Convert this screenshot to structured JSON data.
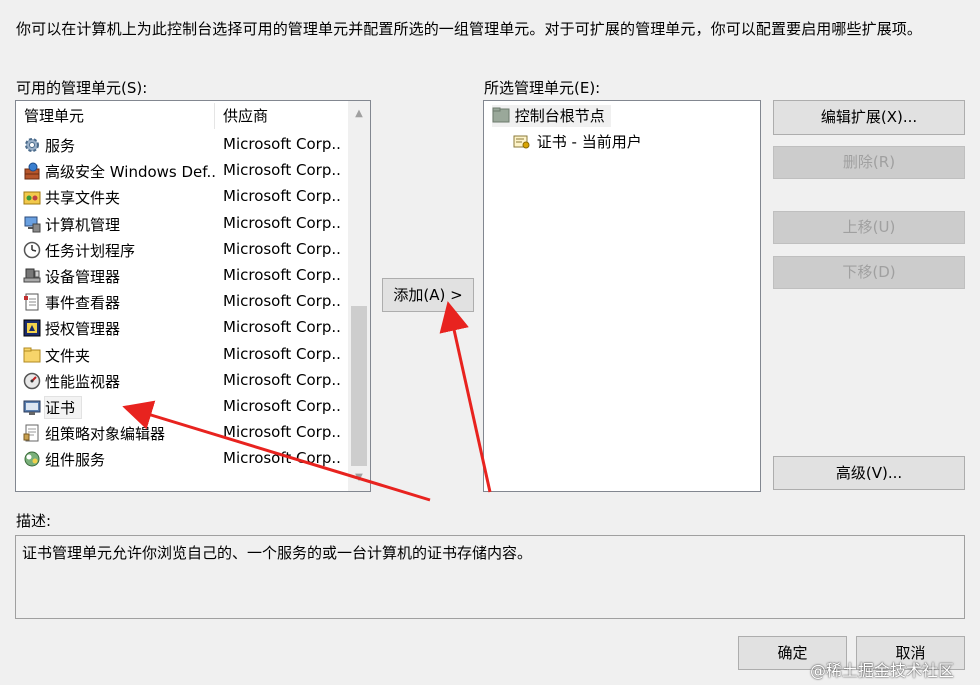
{
  "intro_text": "你可以在计算机上为此控制台选择可用的管理单元并配置所选的一组管理单元。对于可扩展的管理单元，你可以配置要启用哪些扩展项。",
  "available": {
    "label": "可用的管理单元(S):",
    "col_name": "管理单元",
    "col_vendor": "供应商",
    "items": [
      {
        "name": "服务",
        "vendor": "Microsoft Corp...",
        "icon": "gear-icon"
      },
      {
        "name": "高级安全 Windows Def...",
        "vendor": "Microsoft Corp...",
        "icon": "firewall-icon"
      },
      {
        "name": "共享文件夹",
        "vendor": "Microsoft Corp...",
        "icon": "shared-folder-icon"
      },
      {
        "name": "计算机管理",
        "vendor": "Microsoft Corp...",
        "icon": "computer-management-icon"
      },
      {
        "name": "任务计划程序",
        "vendor": "Microsoft Corp...",
        "icon": "clock-icon"
      },
      {
        "name": "设备管理器",
        "vendor": "Microsoft Corp...",
        "icon": "device-manager-icon"
      },
      {
        "name": "事件查看器",
        "vendor": "Microsoft Corp...",
        "icon": "event-viewer-icon"
      },
      {
        "name": "授权管理器",
        "vendor": "Microsoft Corp...",
        "icon": "authorization-icon"
      },
      {
        "name": "文件夹",
        "vendor": "Microsoft Corp...",
        "icon": "folder-icon"
      },
      {
        "name": "性能监视器",
        "vendor": "Microsoft Corp...",
        "icon": "performance-icon"
      },
      {
        "name": "证书",
        "vendor": "Microsoft Corp...",
        "icon": "certificate-icon"
      },
      {
        "name": "组策略对象编辑器",
        "vendor": "Microsoft Corp...",
        "icon": "group-policy-icon"
      },
      {
        "name": "组件服务",
        "vendor": "Microsoft Corp...",
        "icon": "component-services-icon"
      }
    ]
  },
  "add_button": "添加(A) >",
  "selected": {
    "label": "所选管理单元(E):",
    "root": "控制台根节点",
    "child": "证书 - 当前用户"
  },
  "buttons": {
    "edit_ext": "编辑扩展(X)...",
    "remove": "删除(R)",
    "move_up": "上移(U)",
    "move_down": "下移(D)",
    "advanced": "高级(V)...",
    "ok": "确定",
    "cancel": "取消"
  },
  "description": {
    "label": "描述:",
    "text": "证书管理单元允许你浏览自己的、一个服务的或一台计算机的证书存储内容。"
  },
  "watermark": "@稀土掘金技术社区",
  "colors": {
    "annotation_arrow": "#e8231f"
  }
}
